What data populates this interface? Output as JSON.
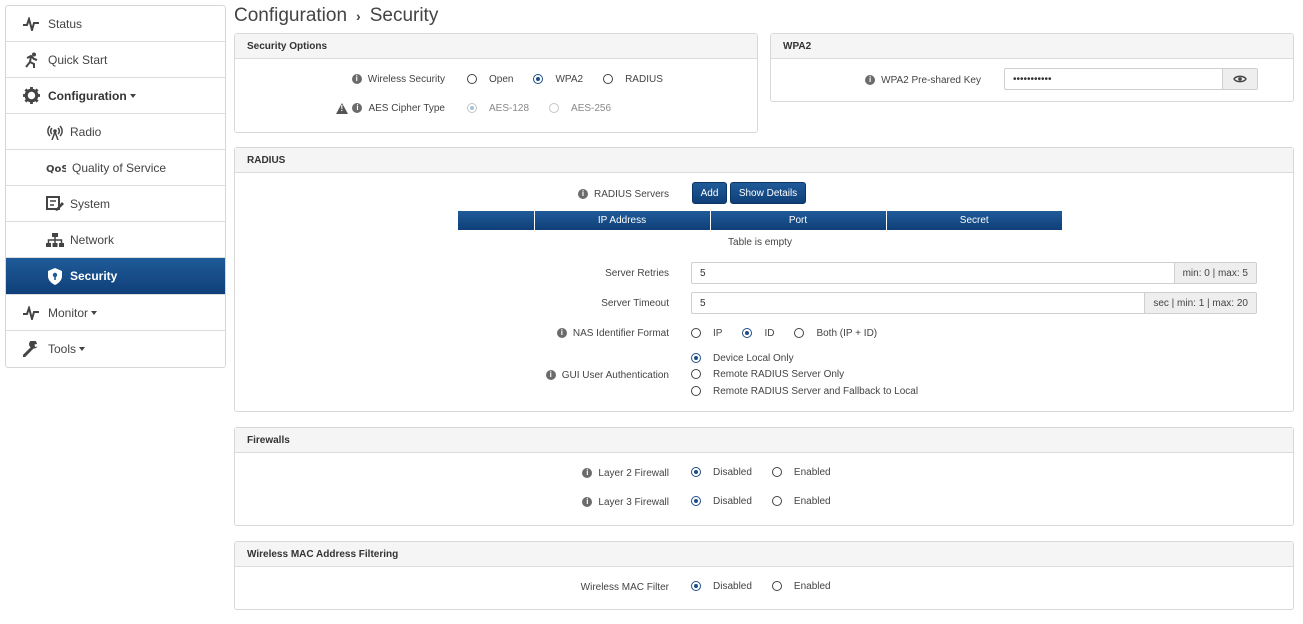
{
  "sidebar": {
    "items": [
      {
        "label": "Status",
        "icon": "pulse-icon"
      },
      {
        "label": "Quick Start",
        "icon": "runner-icon"
      },
      {
        "label": "Configuration",
        "icon": "gear-icon"
      },
      {
        "label": "Radio",
        "icon": "radio-tower-icon"
      },
      {
        "label": "Quality of Service",
        "icon": "qos-icon"
      },
      {
        "label": "System",
        "icon": "system-edit-icon"
      },
      {
        "label": "Network",
        "icon": "network-icon"
      },
      {
        "label": "Security",
        "icon": "shield-icon"
      },
      {
        "label": "Monitor",
        "icon": "pulse-icon"
      },
      {
        "label": "Tools",
        "icon": "wrench-icon"
      }
    ]
  },
  "header": {
    "crumb1": "Configuration",
    "crumb2": "Security"
  },
  "security_options": {
    "title": "Security Options",
    "wireless_security": {
      "label": "Wireless Security",
      "options": [
        "Open",
        "WPA2",
        "RADIUS"
      ],
      "selected": "WPA2"
    },
    "aes_cipher": {
      "label": "AES Cipher Type",
      "options": [
        "AES-128",
        "AES-256"
      ],
      "selected": "AES-128"
    }
  },
  "wpa2": {
    "title": "WPA2",
    "psk_label": "WPA2 Pre-shared Key",
    "psk_value": "•••••••••••"
  },
  "radius": {
    "title": "RADIUS",
    "servers_label": "RADIUS Servers",
    "add_label": "Add",
    "show_details_label": "Show Details",
    "table_headers": [
      "",
      "IP Address",
      "Port",
      "Secret"
    ],
    "table_empty": "Table is empty",
    "retries_label": "Server Retries",
    "retries_value": "5",
    "retries_hint": "min: 0 | max: 5",
    "timeout_label": "Server Timeout",
    "timeout_value": "5",
    "timeout_hint": "sec | min: 1 | max: 20",
    "nas_label": "NAS Identifier Format",
    "nas_options": [
      "IP",
      "ID",
      "Both (IP + ID)"
    ],
    "nas_selected": "ID",
    "gui_label": "GUI User Authentication",
    "gui_options": [
      "Device Local Only",
      "Remote RADIUS Server Only",
      "Remote RADIUS Server and Fallback to Local"
    ],
    "gui_selected": "Device Local Only"
  },
  "firewalls": {
    "title": "Firewalls",
    "l2_label": "Layer 2 Firewall",
    "l3_label": "Layer 3 Firewall",
    "options": [
      "Disabled",
      "Enabled"
    ],
    "l2_selected": "Disabled",
    "l3_selected": "Disabled"
  },
  "mac_filter": {
    "title": "Wireless MAC Address Filtering",
    "label": "Wireless MAC Filter",
    "options": [
      "Disabled",
      "Enabled"
    ],
    "selected": "Disabled"
  },
  "colors": {
    "accent": "#0f3f78",
    "accent_light": "#1f5b99"
  }
}
